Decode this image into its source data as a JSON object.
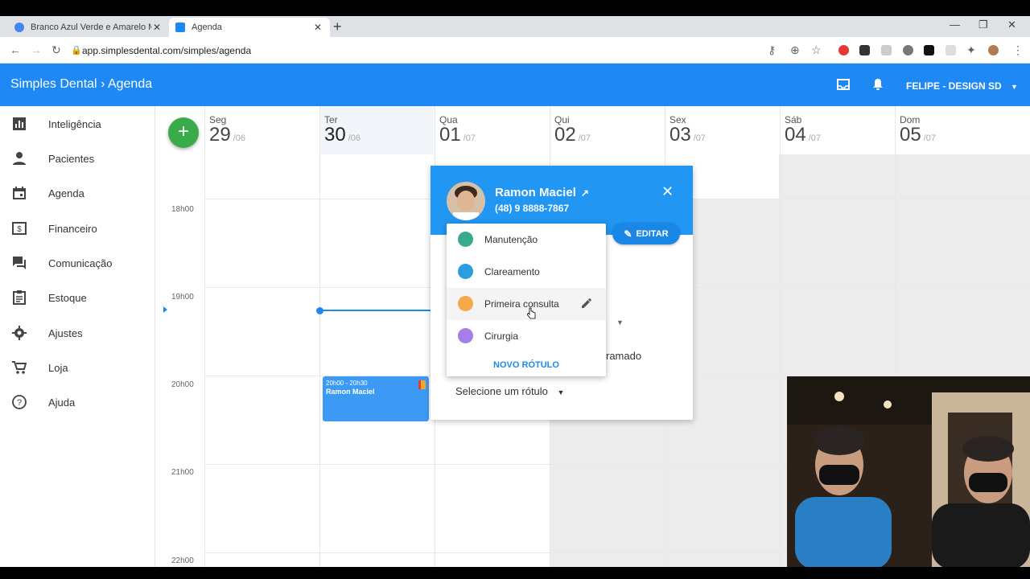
{
  "browser": {
    "tabs": [
      {
        "title": "Branco Azul Verde e Amarelo M...",
        "favicon_color": "#4285f4"
      },
      {
        "title": "Agenda",
        "favicon_color": "#1e88f5"
      }
    ],
    "url": "app.simplesdental.com/simples/agenda"
  },
  "header": {
    "brand": "Simples Dental",
    "section": "Agenda",
    "user": "FELIPE - DESIGN SD"
  },
  "sidebar": {
    "items": [
      {
        "label": "Inteligência",
        "icon": "bar-chart-icon"
      },
      {
        "label": "Pacientes",
        "icon": "person-icon"
      },
      {
        "label": "Agenda",
        "icon": "calendar-icon"
      },
      {
        "label": "Financeiro",
        "icon": "dollar-icon"
      },
      {
        "label": "Comunicação",
        "icon": "chat-icon"
      },
      {
        "label": "Estoque",
        "icon": "clipboard-icon"
      },
      {
        "label": "Ajustes",
        "icon": "gear-icon"
      },
      {
        "label": "Loja",
        "icon": "cart-icon"
      },
      {
        "label": "Ajuda",
        "icon": "help-icon"
      }
    ]
  },
  "calendar": {
    "add_label": "+",
    "days": [
      {
        "name": "Seg",
        "num": "29",
        "month": "/06"
      },
      {
        "name": "Ter",
        "num": "30",
        "month": "/06"
      },
      {
        "name": "Qua",
        "num": "01",
        "month": "/07"
      },
      {
        "name": "Qui",
        "num": "02",
        "month": "/07"
      },
      {
        "name": "Sex",
        "num": "03",
        "month": "/07"
      },
      {
        "name": "Sáb",
        "num": "04",
        "month": "/07"
      },
      {
        "name": "Dom",
        "num": "05",
        "month": "/07"
      }
    ],
    "hours": [
      "18h00",
      "19h00",
      "20h00",
      "21h00",
      "22h00"
    ],
    "appointment": {
      "time": "20h00 - 20h30",
      "patient": "Ramon Maciel"
    }
  },
  "popup": {
    "patient_name": "Ramon Maciel",
    "phone": "(48) 9 8888-7867",
    "edit_label": "EDITAR",
    "status_partial": "ramado",
    "select_label": "Selecione um rótulo"
  },
  "label_menu": {
    "items": [
      {
        "label": "Manutenção",
        "color": "#3aaa8c"
      },
      {
        "label": "Clareamento",
        "color": "#2b9de0"
      },
      {
        "label": "Primeira consulta",
        "color": "#f5a94a"
      },
      {
        "label": "Cirurgia",
        "color": "#a67ee8"
      }
    ],
    "new_label": "NOVO RÓTULO"
  },
  "colors": {
    "primary": "#1e88f5",
    "add_button": "#3aab4a"
  }
}
